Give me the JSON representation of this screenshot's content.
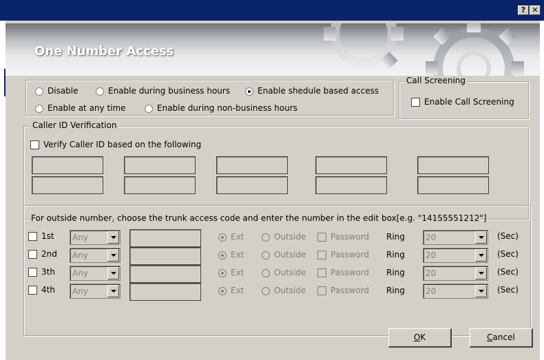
{
  "titlebar": {
    "help_glyph": "?",
    "close_glyph": "✕"
  },
  "banner": {
    "title": "One Number Access"
  },
  "access_mode": {
    "options": [
      {
        "label": "Disable",
        "selected": false
      },
      {
        "label": "Enable during business hours",
        "selected": false
      },
      {
        "label": "Enable shedule based access",
        "selected": true
      },
      {
        "label": "Enable at any time",
        "selected": false
      },
      {
        "label": "Enable during non-business hours",
        "selected": false
      }
    ]
  },
  "call_screening": {
    "legend": "Call Screening",
    "checkbox_label": "Enable Call Screening",
    "checked": false
  },
  "caller_id": {
    "legend": "Caller ID Verification",
    "checkbox_label": "Verify Caller ID based on the following",
    "checked": false
  },
  "outside": {
    "instruction": "For outside number, choose the trunk access code and enter the number in the edit box[e.g. \"14155551212\"]",
    "rows": [
      {
        "label": "1st",
        "code": "Any",
        "ring": "20"
      },
      {
        "label": "2nd",
        "code": "Any",
        "ring": "20"
      },
      {
        "label": "3th",
        "code": "Any",
        "ring": "20"
      },
      {
        "label": "4th",
        "code": "Any",
        "ring": "20"
      }
    ],
    "ext_label": "Ext",
    "outside_label": "Outside",
    "password_label": "Password",
    "ring_label": "Ring",
    "sec_label": "(Sec)"
  },
  "buttons": {
    "ok_underline": "O",
    "ok_rest": "K",
    "cancel_underline": "C",
    "cancel_rest": "ancel"
  }
}
